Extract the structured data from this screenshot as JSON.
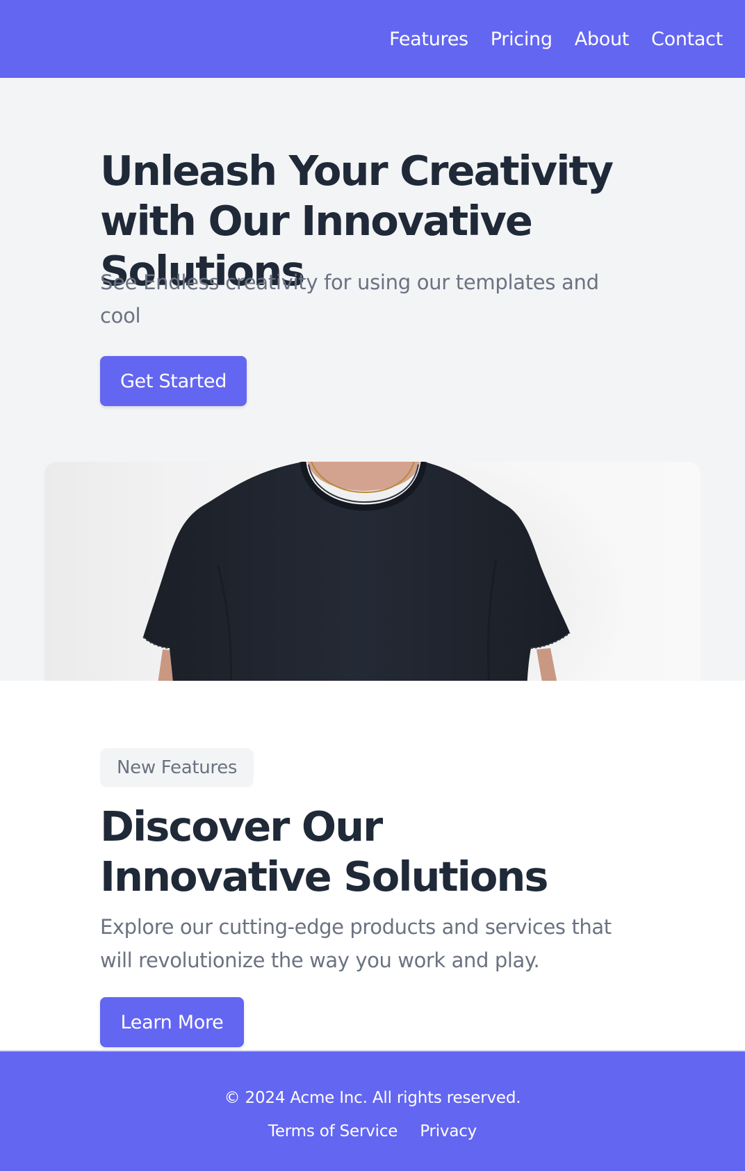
{
  "nav": {
    "links": [
      "Features",
      "Pricing",
      "About",
      "Contact"
    ]
  },
  "hero": {
    "title": "Unleash Your Creativity with Our Innovative Solutions",
    "subtitle": "See Endless creativity for using our templates and cool",
    "cta_label": "Get Started"
  },
  "features": {
    "badge": "New Features",
    "title": "Discover Our Innovative Solutions",
    "text": "Explore our cutting-edge products and services that will revolutionize the way you work and play.",
    "cta_label": "Learn More"
  },
  "footer": {
    "copyright": "© 2024 Acme Inc. All rights reserved.",
    "links": [
      "Terms of Service",
      "Privacy"
    ]
  },
  "colors": {
    "brand": "#6366f1",
    "heading": "#1f2937",
    "muted": "#6b7280",
    "hero_background": "#f3f4f6"
  }
}
